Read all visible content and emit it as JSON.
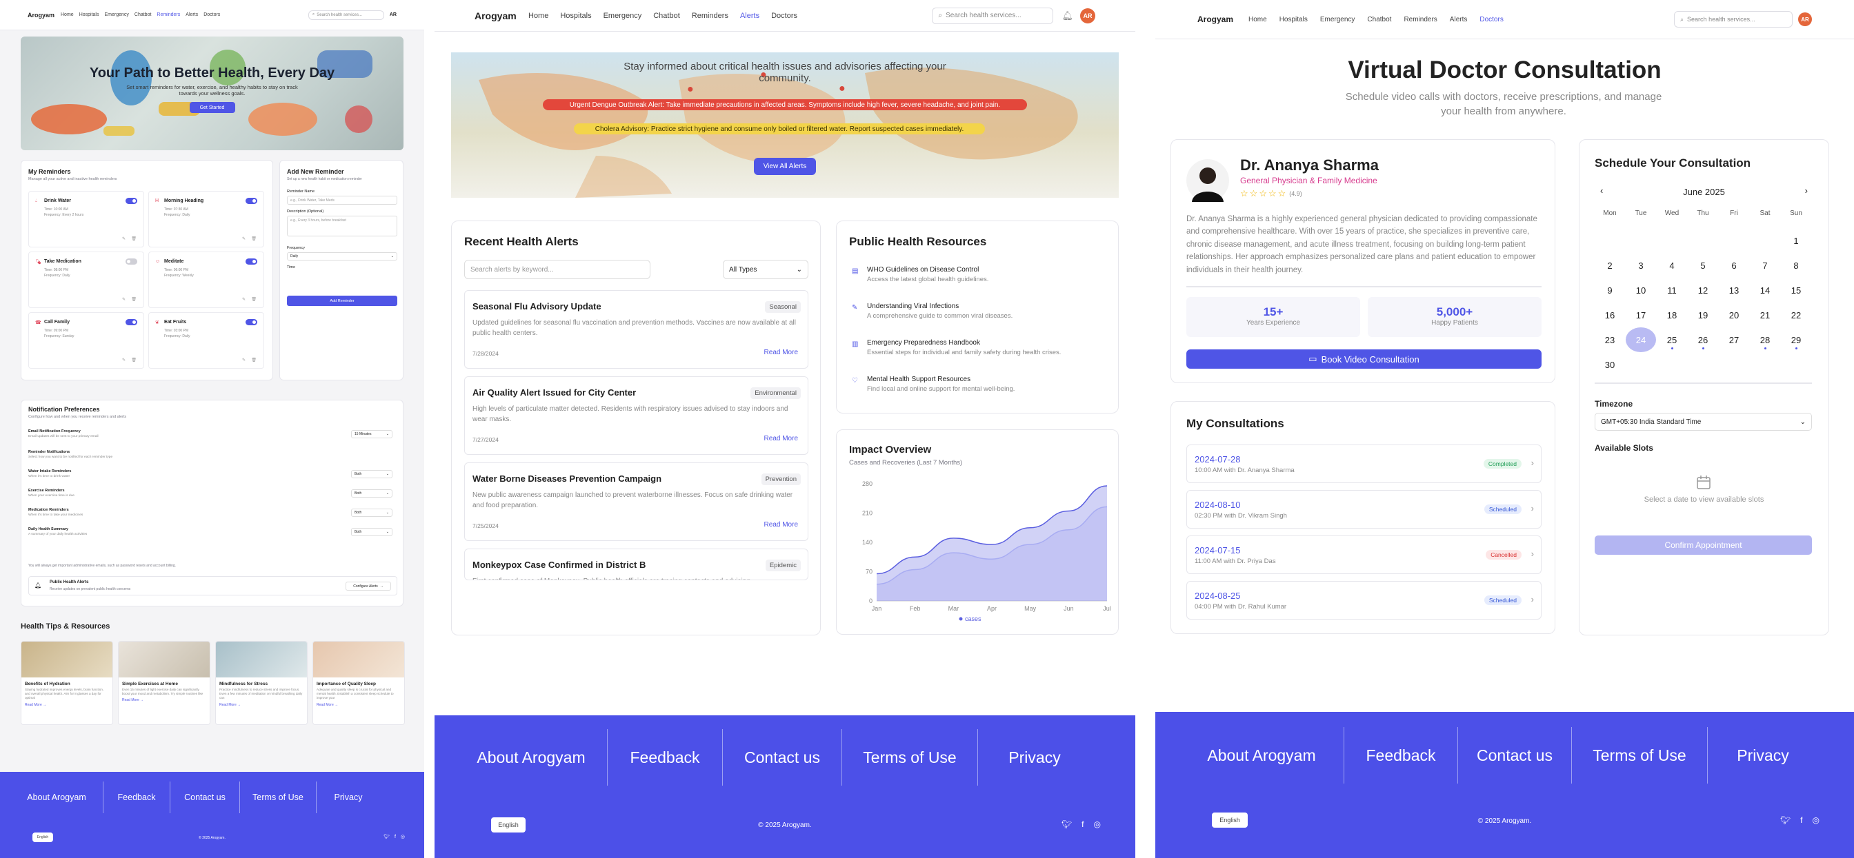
{
  "nav": {
    "brand": "Arogyam",
    "links": [
      "Home",
      "Hospitals",
      "Emergency",
      "Chatbot",
      "Reminders",
      "Alerts",
      "Doctors"
    ],
    "search_placeholder": "Search health services...",
    "avatar": "AR",
    "p1_extra": "AR"
  },
  "p1": {
    "hero": {
      "title": "Your Path to Better Health, Every Day",
      "subtitle": "Set smart reminders for water, exercise, and healthy habits to stay on track towards your wellness goals.",
      "cta": "Get Started"
    },
    "reminders": {
      "title": "My Reminders",
      "subtitle": "Manage all your active and inactive health reminders",
      "items": [
        {
          "name": "Drink Water",
          "time": "Time: 10:00 AM",
          "freq": "Frequency: Every 2 hours",
          "on": true,
          "icon": "water-drop-icon"
        },
        {
          "name": "Morning Heading",
          "time": "Time: 07:30 AM",
          "freq": "Frequency: Daily",
          "on": true,
          "icon": "heading-icon"
        },
        {
          "name": "Take Medication",
          "time": "Time: 08:00 PM",
          "freq": "Frequency: Daily",
          "on": false,
          "icon": "pill-icon"
        },
        {
          "name": "Meditate",
          "time": "Time: 06:00 PM",
          "freq": "Frequency: Weekly",
          "on": true,
          "icon": "meditate-icon"
        },
        {
          "name": "Call Family",
          "time": "Time: 09:00 PM",
          "freq": "Frequency: Sunday",
          "on": true,
          "icon": "phone-icon"
        },
        {
          "name": "Eat Fruits",
          "time": "Time: 03:00 PM",
          "freq": "Frequency: Daily",
          "on": true,
          "icon": "fruit-icon"
        }
      ]
    },
    "add": {
      "title": "Add New Reminder",
      "subtitle": "Set up a new health habit or medication reminder",
      "name_label": "Reminder Name",
      "name_placeholder": "e.g., Drink Water, Take Meds",
      "desc_label": "Description (Optional)",
      "desc_placeholder": "e.g., Every 3 hours, before breakfast",
      "freq_label": "Frequency",
      "freq_value": "Daily",
      "time_label": "Time",
      "button": "Add Reminder"
    },
    "notif": {
      "title": "Notification Preferences",
      "subtitle": "Configure how and when you receive reminders and alerts",
      "rows": [
        {
          "label": "Email Notification Frequency",
          "desc": "Email updates will be sent to your primary email",
          "value": "15 Minutes"
        },
        {
          "label": "Reminder Notifications",
          "desc": "Select how you want to be notified for each reminder type",
          "value": ""
        },
        {
          "label": "Water Intake Reminders",
          "desc": "When it's time to drink water",
          "value": "Both"
        },
        {
          "label": "Exercise Reminders",
          "desc": "When your exercise time is due",
          "value": "Both"
        },
        {
          "label": "Medication Reminders",
          "desc": "When it's time to take your medicines",
          "value": "Both"
        },
        {
          "label": "Daily Health Summary",
          "desc": "A summary of your daily health activities",
          "value": "Both"
        }
      ],
      "note": "You will always get important administrative emails, such as password resets and account billing.",
      "alerts_title": "Public Health Alerts",
      "alerts_desc": "Receive updates on prevalent public health concerns",
      "alerts_button": "Configure Alerts"
    },
    "tips": {
      "title": "Health Tips & Resources",
      "items": [
        {
          "title": "Benefits of Hydration",
          "desc": "Staying hydrated improves energy levels, brain function, and overall physical health. Aim for 8 glasses a day for optimal",
          "link": "Read More"
        },
        {
          "title": "Simple Exercises at Home",
          "desc": "Even 15 minutes of light exercise daily can significantly boost your mood and metabolism. Try simple routines like",
          "link": "Read More"
        },
        {
          "title": "Mindfulness for Stress",
          "desc": "Practice mindfulness to reduce stress and improve focus. Even a few minutes of meditation or mindful breathing daily can",
          "link": "Read More"
        },
        {
          "title": "Importance of Quality Sleep",
          "desc": "Adequate and quality sleep is crucial for physical and mental health. Establish a consistent sleep schedule to improve your",
          "link": "Read More"
        }
      ]
    }
  },
  "p2": {
    "banner": {
      "text": "Stay informed about critical health issues and advisories affecting your community.",
      "alert1": "Urgent Dengue Outbreak Alert: Take immediate precautions in affected areas. Symptoms include high fever, severe headache, and joint pain.",
      "alert2": "Cholera Advisory: Practice strict hygiene and consume only boiled or filtered water. Report suspected cases immediately.",
      "button": "View All Alerts"
    },
    "recent": {
      "title": "Recent Health Alerts",
      "search_placeholder": "Search alerts by keyword...",
      "filter": "All Types",
      "items": [
        {
          "title": "Seasonal Flu Advisory Update",
          "tag": "Seasonal",
          "desc": "Updated guidelines for seasonal flu vaccination and prevention methods. Vaccines are now available at all public health centers.",
          "date": "7/28/2024",
          "link": "Read More"
        },
        {
          "title": "Air Quality Alert Issued for City Center",
          "tag": "Environmental",
          "desc": "High levels of particulate matter detected. Residents with respiratory issues advised to stay indoors and wear masks.",
          "date": "7/27/2024",
          "link": "Read More"
        },
        {
          "title": "Water Borne Diseases Prevention Campaign",
          "tag": "Prevention",
          "desc": "New public awareness campaign launched to prevent waterborne illnesses. Focus on safe drinking water and food preparation.",
          "date": "7/25/2024",
          "link": "Read More"
        },
        {
          "title": "Monkeypox Case Confirmed in District B",
          "tag": "Epidemic",
          "desc": "First confirmed case of Monkeypox. Public health officials are tracing contacts and advising",
          "date": "",
          "link": ""
        }
      ]
    },
    "resources": {
      "title": "Public Health Resources",
      "items": [
        {
          "title": "WHO Guidelines on Disease Control",
          "desc": "Access the latest global health guidelines.",
          "icon": "document-icon"
        },
        {
          "title": "Understanding Viral Infections",
          "desc": "A comprehensive guide to common viral diseases.",
          "icon": "pen-icon"
        },
        {
          "title": "Emergency Preparedness Handbook",
          "desc": "Essential steps for individual and family safety during health crises.",
          "icon": "book-icon"
        },
        {
          "title": "Mental Health Support Resources",
          "desc": "Find local and online support for mental well-being.",
          "icon": "heart-hands-icon"
        }
      ]
    },
    "impact": {
      "title": "Impact Overview",
      "subtitle": "Cases and Recoveries (Last 7 Months)",
      "legend": "cases"
    }
  },
  "chart_data": {
    "type": "area",
    "title": "Impact Overview",
    "subtitle": "Cases and Recoveries (Last 7 Months)",
    "categories": [
      "Jan",
      "Feb",
      "Mar",
      "Apr",
      "May",
      "Jun",
      "Jul"
    ],
    "series": [
      {
        "name": "cases",
        "values": [
          65,
          105,
          150,
          135,
          175,
          215,
          275
        ],
        "color": "#5b5fe0"
      },
      {
        "values": [
          40,
          75,
          115,
          100,
          135,
          170,
          225
        ],
        "color": "#a8acf2"
      }
    ],
    "yticks": [
      0,
      70,
      140,
      210,
      280
    ],
    "ylim": [
      0,
      280
    ],
    "grid": false,
    "legend": "bottom"
  },
  "p3": {
    "hero": {
      "title": "Virtual Doctor Consultation",
      "subtitle": "Schedule video calls with doctors, receive prescriptions, and manage your health from anywhere."
    },
    "doctor": {
      "name": "Dr. Ananya Sharma",
      "specialty": "General Physician & Family Medicine",
      "rating": "(4.9)",
      "bio": "Dr. Ananya Sharma is a highly experienced general physician dedicated to providing compassionate and comprehensive healthcare. With over 15 years of practice, she specializes in preventive care, chronic disease management, and acute illness treatment, focusing on building long-term patient relationships. Her approach emphasizes personalized care plans and patient education to empower individuals in their health journey.",
      "stat1_value": "15+",
      "stat1_label": "Years Experience",
      "stat2_value": "5,000+",
      "stat2_label": "Happy Patients",
      "button": "Book Video Consultation"
    },
    "consultations": {
      "title": "My Consultations",
      "items": [
        {
          "date": "2024-07-28",
          "detail": "10:00 AM with Dr. Ananya Sharma",
          "status": "Completed",
          "color": "#1f9d55",
          "bg": "#e3f6ea"
        },
        {
          "date": "2024-08-10",
          "detail": "02:30 PM with Dr. Vikram Singh",
          "status": "Scheduled",
          "color": "#3456d6",
          "bg": "#e6ecfd"
        },
        {
          "date": "2024-07-15",
          "detail": "11:00 AM with Dr. Priya Das",
          "status": "Cancelled",
          "color": "#d93030",
          "bg": "#fde6e6"
        },
        {
          "date": "2024-08-25",
          "detail": "04:00 PM with Dr. Rahul Kumar",
          "status": "Scheduled",
          "color": "#3456d6",
          "bg": "#e6ecfd"
        }
      ]
    },
    "schedule": {
      "title": "Schedule Your Consultation",
      "month": "June 2025",
      "weekdays": [
        "Mon",
        "Tue",
        "Wed",
        "Thu",
        "Fri",
        "Sat",
        "Sun"
      ],
      "days": [
        "",
        "",
        "",
        "",
        "",
        "",
        "1",
        "2",
        "3",
        "4",
        "5",
        "6",
        "7",
        "8",
        "9",
        "10",
        "11",
        "12",
        "13",
        "14",
        "15",
        "16",
        "17",
        "18",
        "19",
        "20",
        "21",
        "22",
        "23",
        "24",
        "25",
        "26",
        "27",
        "28",
        "29",
        "30"
      ],
      "selected": "24",
      "dotted": [
        "25",
        "26",
        "28",
        "29"
      ],
      "timezone_label": "Timezone",
      "timezone": "GMT+05:30 India Standard Time",
      "slots_label": "Available Slots",
      "slots_empty": "Select a date to view available slots",
      "confirm": "Confirm Appointment"
    }
  },
  "footer": {
    "links": [
      "About Arogyam",
      "Feedback",
      "Contact us",
      "Terms of Use",
      "Privacy"
    ],
    "lang": "English",
    "copyright": "© 2025 Arogyam."
  }
}
